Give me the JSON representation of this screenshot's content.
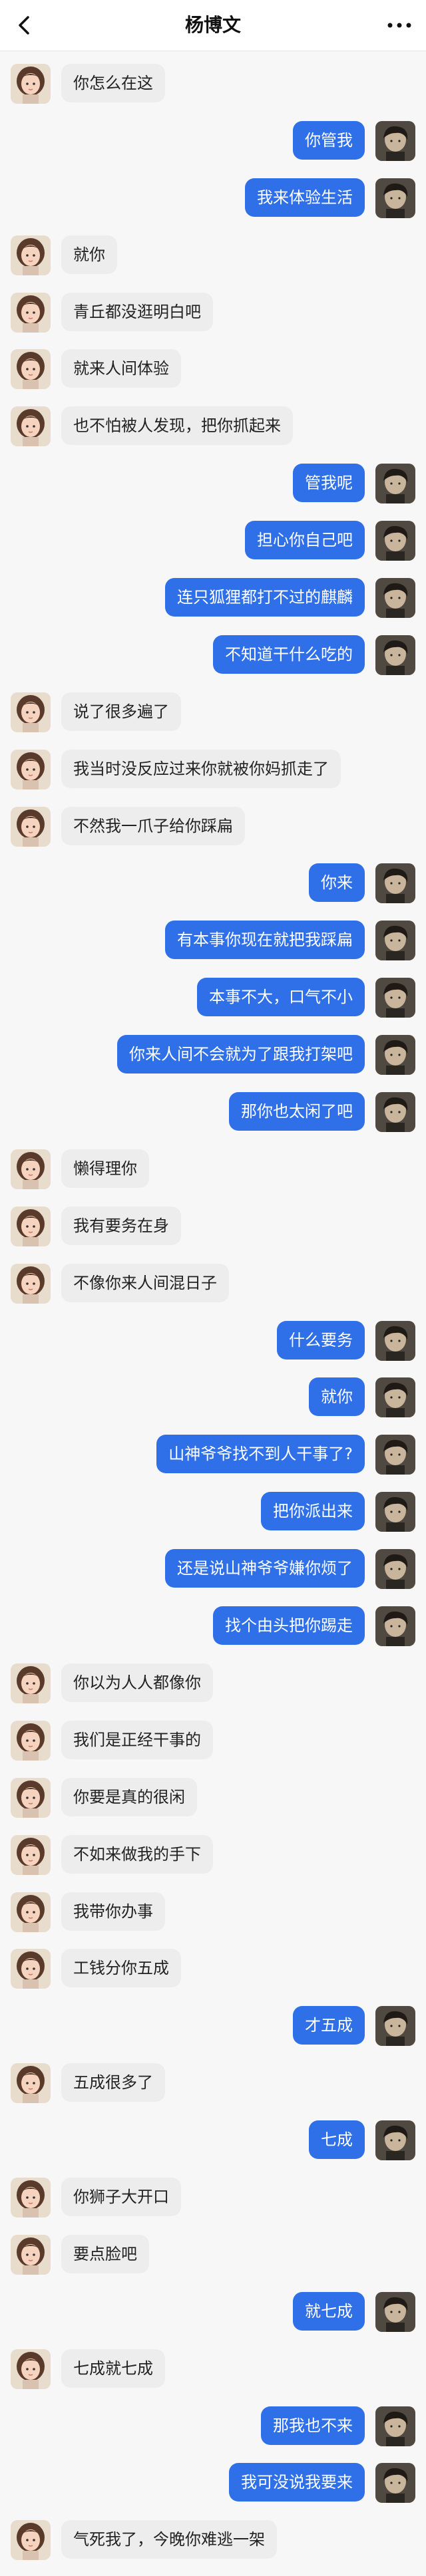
{
  "header": {
    "title": "杨博文"
  },
  "messages": [
    {
      "side": "left",
      "text": "你怎么在这"
    },
    {
      "side": "right",
      "text": "你管我"
    },
    {
      "side": "right",
      "text": "我来体验生活"
    },
    {
      "side": "left",
      "text": "就你"
    },
    {
      "side": "left",
      "text": "青丘都没逛明白吧"
    },
    {
      "side": "left",
      "text": "就来人间体验"
    },
    {
      "side": "left",
      "text": "也不怕被人发现，把你抓起来"
    },
    {
      "side": "right",
      "text": "管我呢"
    },
    {
      "side": "right",
      "text": "担心你自己吧"
    },
    {
      "side": "right",
      "text": "连只狐狸都打不过的麒麟"
    },
    {
      "side": "right",
      "text": "不知道干什么吃的"
    },
    {
      "side": "left",
      "text": "说了很多遍了"
    },
    {
      "side": "left",
      "text": "我当时没反应过来你就被你妈抓走了"
    },
    {
      "side": "left",
      "text": "不然我一爪子给你踩扁"
    },
    {
      "side": "right",
      "text": "你来"
    },
    {
      "side": "right",
      "text": "有本事你现在就把我踩扁"
    },
    {
      "side": "right",
      "text": "本事不大，口气不小"
    },
    {
      "side": "right",
      "text": "你来人间不会就为了跟我打架吧"
    },
    {
      "side": "right",
      "text": "那你也太闲了吧"
    },
    {
      "side": "left",
      "text": "懒得理你"
    },
    {
      "side": "left",
      "text": "我有要务在身"
    },
    {
      "side": "left",
      "text": "不像你来人间混日子"
    },
    {
      "side": "right",
      "text": "什么要务"
    },
    {
      "side": "right",
      "text": "就你"
    },
    {
      "side": "right",
      "text": "山神爷爷找不到人干事了?"
    },
    {
      "side": "right",
      "text": "把你派出来"
    },
    {
      "side": "right",
      "text": "还是说山神爷爷嫌你烦了"
    },
    {
      "side": "right",
      "text": "找个由头把你踢走"
    },
    {
      "side": "left",
      "text": "你以为人人都像你"
    },
    {
      "side": "left",
      "text": "我们是正经干事的"
    },
    {
      "side": "left",
      "text": "你要是真的很闲"
    },
    {
      "side": "left",
      "text": "不如来做我的手下"
    },
    {
      "side": "left",
      "text": "我带你办事"
    },
    {
      "side": "left",
      "text": "工钱分你五成"
    },
    {
      "side": "right",
      "text": "才五成"
    },
    {
      "side": "left",
      "text": "五成很多了"
    },
    {
      "side": "right",
      "text": "七成"
    },
    {
      "side": "left",
      "text": "你狮子大开口"
    },
    {
      "side": "left",
      "text": "要点脸吧"
    },
    {
      "side": "right",
      "text": "就七成"
    },
    {
      "side": "left",
      "text": "七成就七成"
    },
    {
      "side": "right",
      "text": "那我也不来"
    },
    {
      "side": "right",
      "text": "我可没说我要来"
    },
    {
      "side": "left",
      "text": "气死我了，今晚你难逃一架"
    }
  ],
  "colors": {
    "sent_bubble": "#2f6fe8",
    "received_bubble": "#ededed",
    "background": "#f7f7f7"
  },
  "icons": {
    "back": "chevron-left-icon",
    "more": "more-dots-icon"
  }
}
